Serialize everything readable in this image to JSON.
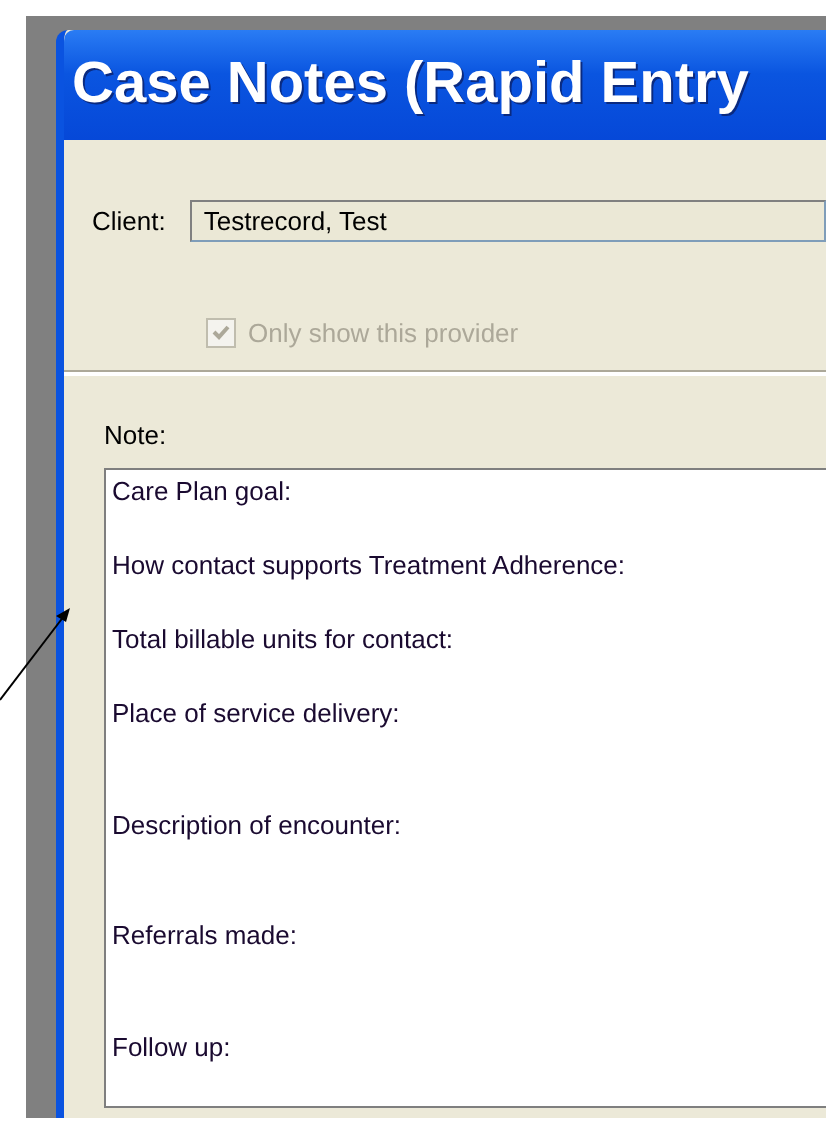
{
  "window": {
    "title": "Case Notes (Rapid Entry"
  },
  "client": {
    "label": "Client:",
    "value": "Testrecord, Test"
  },
  "provider_filter": {
    "label": "Only show this provider",
    "checked": true,
    "disabled": true
  },
  "note": {
    "label": "Note:",
    "lines": [
      {
        "text": "Care Plan goal:",
        "kind": "short"
      },
      {
        "text": "How contact supports Treatment Adherence:",
        "kind": "short"
      },
      {
        "text": "Total billable units for contact:",
        "kind": "short"
      },
      {
        "text": "Place of service delivery:",
        "kind": "long"
      },
      {
        "text": "Description of encounter:",
        "kind": "long"
      },
      {
        "text": "Referrals made:",
        "kind": "long"
      },
      {
        "text": "Follow up:",
        "kind": "short"
      }
    ]
  }
}
